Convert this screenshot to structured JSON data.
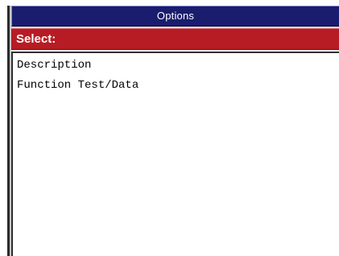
{
  "window": {
    "title": "Options"
  },
  "header": {
    "select_label": "Select:"
  },
  "list": {
    "items": [
      {
        "label": "Description"
      },
      {
        "label": "Function Test/Data"
      }
    ]
  },
  "colors": {
    "titlebar": "#1a1d6e",
    "selectbar": "#b71c24",
    "text": "#000000",
    "background": "#ffffff"
  }
}
